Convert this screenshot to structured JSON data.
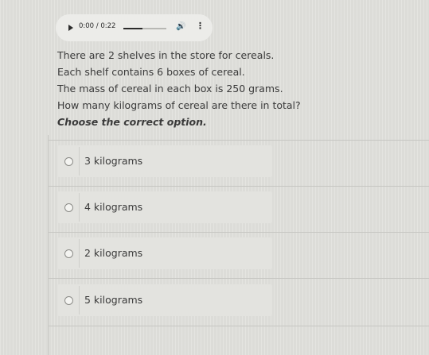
{
  "player": {
    "play_icon": "play-icon",
    "time": "0:00 / 0:22",
    "progress": 0.45,
    "volume_icon": "volume-icon",
    "volume_glyph": "🔊",
    "menu_icon": "more-vert-icon",
    "menu_glyph": "⋮"
  },
  "question": {
    "lines": [
      "There are 2 shelves in the store for cereals.",
      "Each shelf contains 6 boxes of cereal.",
      "The mass of cereal in each box is 250 grams.",
      "How many kilograms of cereal are there in total?"
    ],
    "instruction": "Choose the correct option."
  },
  "options": [
    {
      "label": "3 kilograms"
    },
    {
      "label": "4 kilograms"
    },
    {
      "label": "2 kilograms"
    },
    {
      "label": "5 kilograms"
    }
  ]
}
